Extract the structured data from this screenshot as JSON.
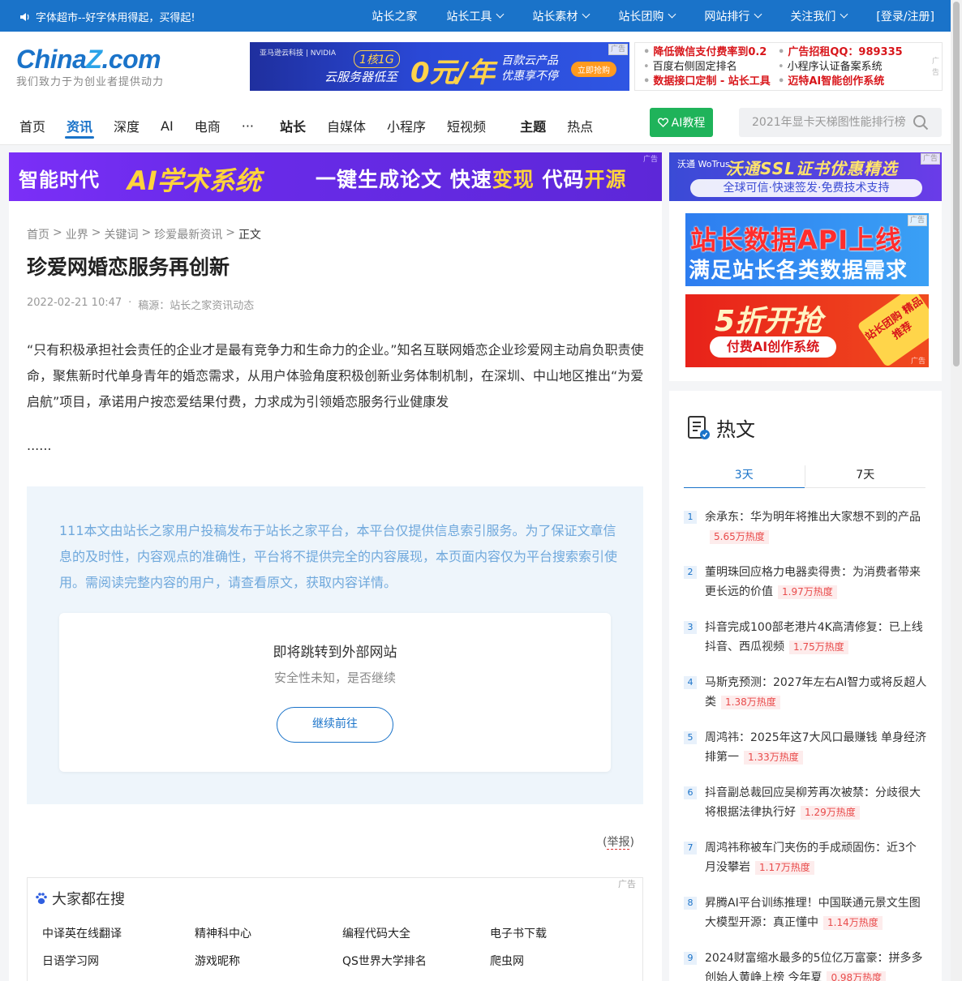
{
  "topbar": {
    "notice": "字体超市--好字体用得起，买得起!",
    "nav": [
      {
        "label": "站长之家",
        "dropdown": false
      },
      {
        "label": "站长工具",
        "dropdown": true
      },
      {
        "label": "站长素材",
        "dropdown": true
      },
      {
        "label": "站长团购",
        "dropdown": true
      },
      {
        "label": "网站排行",
        "dropdown": true
      },
      {
        "label": "关注我们",
        "dropdown": true
      },
      {
        "label": "[登录/注册]",
        "dropdown": false
      }
    ]
  },
  "logo": {
    "brand_a": "China",
    "brand_z": "Z",
    "brand_b": ".com",
    "tagline": "我们致力于为创业者提供动力"
  },
  "ad_cloud": {
    "vendor": "亚马逊云科技 | NVIDIA",
    "spec": "1核1G",
    "line2": "云服务器低至",
    "price": "0元/年",
    "r1": "百款云产品",
    "r2": "优惠享不停",
    "button": "立即抢购",
    "tag": "广告"
  },
  "text_ads": {
    "rows": [
      [
        {
          "text": "降低微信支付费率到0.2",
          "red": true
        },
        {
          "text": "广告招租QQ：989335",
          "red": true
        }
      ],
      [
        {
          "text": "百度右侧固定排名",
          "red": false
        },
        {
          "text": "小程序认证备案系统",
          "red": false
        }
      ],
      [
        {
          "text": "数据接口定制 - 站长工具",
          "red": true
        },
        {
          "text": "迈特AI智能创作系统",
          "red": true
        }
      ]
    ],
    "tag": "广告"
  },
  "main_nav": [
    {
      "label": "首页",
      "style": "normal",
      "gap": 26
    },
    {
      "label": "资讯",
      "style": "active",
      "gap": 26
    },
    {
      "label": "深度",
      "style": "normal",
      "gap": 26
    },
    {
      "label": "AI",
      "style": "normal",
      "gap": 26
    },
    {
      "label": "电商",
      "style": "normal",
      "gap": 26
    },
    {
      "label": "···",
      "style": "normal",
      "gap": 32
    },
    {
      "label": "站长",
      "style": "bold",
      "gap": 26
    },
    {
      "label": "自媒体",
      "style": "normal",
      "gap": 26
    },
    {
      "label": "小程序",
      "style": "normal",
      "gap": 26
    },
    {
      "label": "短视频",
      "style": "normal",
      "gap": 42
    },
    {
      "label": "主题",
      "style": "bold",
      "gap": 26
    },
    {
      "label": "热点",
      "style": "normal",
      "gap": 0
    }
  ],
  "ai_button": "AI教程",
  "search": {
    "placeholder": "2021年显卡天梯图性能排行榜"
  },
  "banner_ai": {
    "t1": "智能时代",
    "t2": "AI学术系统",
    "t3a": "一键生成论文 快速",
    "t3b": "变现",
    "t3c": " 代码",
    "t3d": "开源",
    "tag": "广告"
  },
  "banner_ssl": {
    "logo": "沃通 WoTrus",
    "title": "沃通SSL证书优惠精选",
    "sub": "全球可信·快速签发·免费技术支持",
    "tag": "广告"
  },
  "article": {
    "breadcrumb": [
      "首页",
      ">",
      "业界",
      ">",
      "关键词",
      ">",
      "珍爱最新资讯",
      ">",
      "正文"
    ],
    "title": "珍爱网婚恋服务再创新",
    "date": "2022-02-21 10:47",
    "dot": "·",
    "source": "稿源：站长之家资讯动态",
    "body": "“只有积极承担社会责任的企业才是最有竞争力和生命力的企业。”知名互联网婚恋企业珍爱网主动肩负职责使命，聚焦新时代单身青年的婚恋需求，从用户体验角度积极创新业务体制机制，在深圳、中山地区推出“为爱启航”项目，承诺用户按恋爱结果付费，力求成为引领婚恋服务行业健康发",
    "ellipsis": "......",
    "notice": "111本文由站长之家用户投稿发布于站长之家平台，本平台仅提供信息索引服务。为了保证文章信息的及时性，内容观点的准确性，平台将不提供完全的内容展现，本页面内容仅为平台搜索索引使用。需阅读完整内容的用户，请查看原文，获取内容详情。",
    "redirect_title": "即将跳转到外部网站",
    "redirect_sub": "安全性未知，是否继续",
    "redirect_button": "继续前往",
    "report_open": "(",
    "report": "举报",
    "report_close": ")"
  },
  "search_box": {
    "title": "大家都在搜",
    "tag": "广告",
    "items": [
      "中译英在线翻译",
      "精神科中心",
      "编程代码大全",
      "电子书下载",
      "日语学习网",
      "游戏昵称",
      "QS世界大学排名",
      "爬虫网"
    ]
  },
  "side_ads": {
    "api_l1": "站长数据API上线",
    "api_l2": "满足站长各类数据需求",
    "sale_l1": "5折开抢",
    "sale_l2": "付费AI创作系统",
    "sale_stamp": "站长团购 精品推荐",
    "tag": "广告"
  },
  "hot": {
    "title": "热文",
    "tabs": [
      {
        "label": "3天",
        "active": true
      },
      {
        "label": "7天",
        "active": false
      }
    ],
    "items": [
      {
        "rank": "1",
        "text": "余承东：华为明年将推出大家想不到的产品",
        "heat": "5.65万热度"
      },
      {
        "rank": "2",
        "text": "董明珠回应格力电器卖得贵：为消费者带来更长远的价值",
        "heat": "1.97万热度"
      },
      {
        "rank": "3",
        "text": "抖音完成100部老港片4K高清修复：已上线抖音、西瓜视频",
        "heat": "1.75万热度"
      },
      {
        "rank": "4",
        "text": "马斯克预测：2027年左右AI智力或将反超人类",
        "heat": "1.38万热度"
      },
      {
        "rank": "5",
        "text": "周鸿祎：2025年这7大风口最赚钱 单身经济排第一",
        "heat": "1.33万热度"
      },
      {
        "rank": "6",
        "text": "抖音副总裁回应吴柳芳再次被禁：分歧很大 将根据法律执行好",
        "heat": "1.29万热度"
      },
      {
        "rank": "7",
        "text": "周鸿祎称被车门夹伤的手成顽固伤：近3个月没攀岩",
        "heat": "1.17万热度"
      },
      {
        "rank": "8",
        "text": "昇腾AI平台训练推理！中国联通元景文生图大模型开源：真正懂中",
        "heat": "1.14万热度"
      },
      {
        "rank": "9",
        "text": "2024财富缩水最多的5位亿万富豪：拼多多创始人黄峥上榜 今年夏",
        "heat": "0.98万热度"
      }
    ]
  },
  "colors": {
    "primary": "#1a73c9",
    "green": "#1fb35a",
    "red": "#d8161b",
    "heat": "#e94b4b"
  }
}
